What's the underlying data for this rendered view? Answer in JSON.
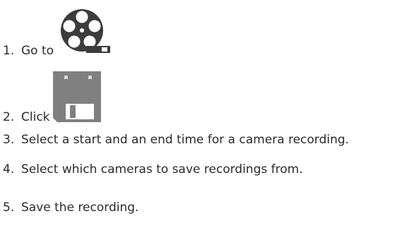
{
  "steps": [
    {
      "number": "1.",
      "text": "Go to",
      "icon": "film-reel-icon"
    },
    {
      "number": "2.",
      "text": "Click",
      "icon": "save-disk-icon"
    },
    {
      "number": "3.",
      "text": "Select a start and an end time for a camera recording."
    },
    {
      "number": "4.",
      "text": "Select which cameras to save recordings from."
    },
    {
      "number": "5.",
      "text": "Save the recording."
    }
  ],
  "colors": {
    "text": "#2b2b2b",
    "icon_dark": "#3c3c3c",
    "icon_light": "#ffffff",
    "disk_gray": "#808080"
  }
}
